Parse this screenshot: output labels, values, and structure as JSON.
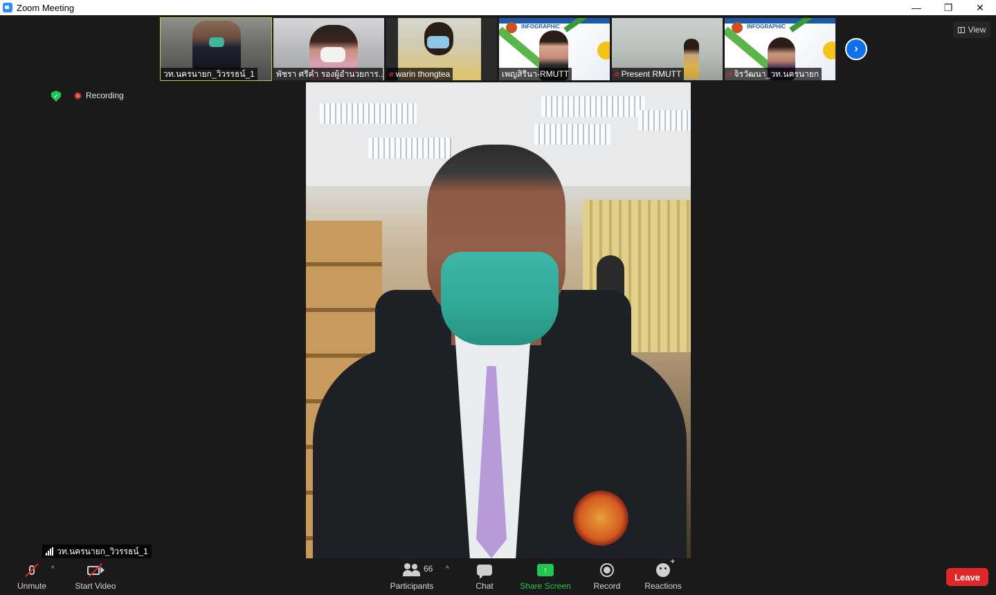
{
  "window": {
    "title": "Zoom Meeting",
    "minimize_glyph": "—",
    "restore_glyph": "❐",
    "close_glyph": "✕"
  },
  "thumbnails": [
    {
      "name": "วท.นครนายก_วิวรรธน์_1",
      "muted": false,
      "active": true
    },
    {
      "name": "พัชรา ศรีคำ รองผู้อำนวยการ...",
      "muted": false,
      "active": false
    },
    {
      "name": "warin thongtea",
      "muted": true,
      "active": false
    },
    {
      "name": "เพญสิรีนา-RMUTT",
      "muted": false,
      "active": false
    },
    {
      "name": "Present RMUTT",
      "muted": true,
      "active": false
    },
    {
      "name": "จิรวัฒนา_วท.นครนายก",
      "muted": true,
      "active": false
    }
  ],
  "poster": {
    "title": "INFOGRAPHIC"
  },
  "view_button": {
    "label": "View"
  },
  "status": {
    "recording_label": "Recording"
  },
  "speaker": {
    "name": "วท.นครนายก_วิวรรธน์_1"
  },
  "toolbar": {
    "unmute_label": "Unmute",
    "start_video_label": "Start Video",
    "participants_label": "Participants",
    "participants_count": "66",
    "chat_label": "Chat",
    "share_screen_label": "Share Screen",
    "record_label": "Record",
    "reactions_label": "Reactions",
    "leave_label": "Leave"
  },
  "colors": {
    "accent_blue": "#0e71eb",
    "share_green": "#23c552",
    "leave_red": "#e02828",
    "active_border": "#b5cf5a",
    "background": "#1a1a1a"
  },
  "icons": [
    "zoom-app-icon",
    "muted-mic-icon",
    "next-page-icon",
    "view-grid-icon",
    "shield-icon",
    "recording-dot-icon",
    "signal-icon",
    "mic-icon",
    "video-camera-icon",
    "participants-icon",
    "chat-icon",
    "share-screen-icon",
    "record-icon",
    "reactions-icon"
  ]
}
